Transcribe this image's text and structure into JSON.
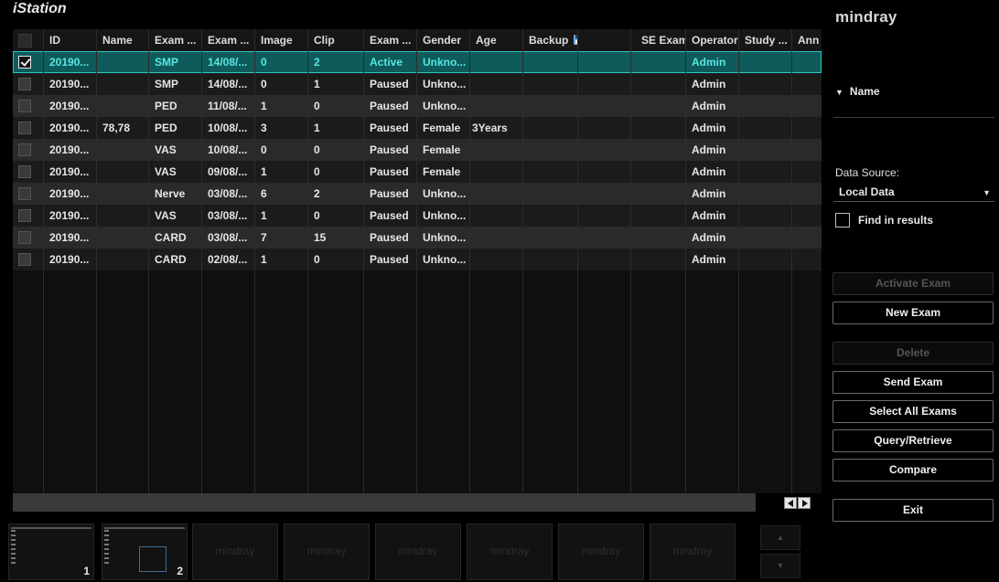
{
  "app": {
    "title": "iStation",
    "brand": "mindray"
  },
  "table": {
    "columns": [
      "ID",
      "Name",
      "Exam ...",
      "Exam ...",
      "Image",
      "Clip",
      "Exam ...",
      "Gender",
      "Age",
      "Backup",
      "",
      "SE Exam",
      "Operator",
      "Study ...",
      "Ann"
    ],
    "rows": [
      {
        "checked": true,
        "cells": [
          "20190...",
          "",
          "SMP",
          "14/08/...",
          "0",
          "2",
          "Active",
          "Unkno...",
          "",
          "",
          "",
          "",
          "Admin",
          "",
          ""
        ]
      },
      {
        "checked": false,
        "cells": [
          "20190...",
          "",
          "SMP",
          "14/08/...",
          "0",
          "1",
          "Paused",
          "Unkno...",
          "",
          "",
          "",
          "",
          "Admin",
          "",
          ""
        ]
      },
      {
        "checked": false,
        "cells": [
          "20190...",
          "",
          "PED",
          "11/08/...",
          "1",
          "0",
          "Paused",
          "Unkno...",
          "",
          "",
          "",
          "",
          "Admin",
          "",
          ""
        ]
      },
      {
        "checked": false,
        "cells": [
          "20190...",
          "78,78",
          "PED",
          "10/08/...",
          "3",
          "1",
          "Paused",
          "Female",
          "3Years",
          "",
          "",
          "",
          "Admin",
          "",
          ""
        ]
      },
      {
        "checked": false,
        "cells": [
          "20190...",
          "",
          "VAS",
          "10/08/...",
          "0",
          "0",
          "Paused",
          "Female",
          "",
          "",
          "",
          "",
          "Admin",
          "",
          ""
        ]
      },
      {
        "checked": false,
        "cells": [
          "20190...",
          "",
          "VAS",
          "09/08/...",
          "1",
          "0",
          "Paused",
          "Female",
          "",
          "",
          "",
          "",
          "Admin",
          "",
          ""
        ]
      },
      {
        "checked": false,
        "cells": [
          "20190...",
          "",
          "Nerve",
          "03/08/...",
          "6",
          "2",
          "Paused",
          "Unkno...",
          "",
          "",
          "",
          "",
          "Admin",
          "",
          ""
        ]
      },
      {
        "checked": false,
        "cells": [
          "20190...",
          "",
          "VAS",
          "03/08/...",
          "1",
          "0",
          "Paused",
          "Unkno...",
          "",
          "",
          "",
          "",
          "Admin",
          "",
          ""
        ]
      },
      {
        "checked": false,
        "cells": [
          "20190...",
          "",
          "CARD",
          "03/08/...",
          "7",
          "15",
          "Paused",
          "Unkno...",
          "",
          "",
          "",
          "",
          "Admin",
          "",
          ""
        ]
      },
      {
        "checked": false,
        "cells": [
          "20190...",
          "",
          "CARD",
          "02/08/...",
          "1",
          "0",
          "Paused",
          "Unkno...",
          "",
          "",
          "",
          "",
          "Admin",
          "",
          ""
        ]
      }
    ],
    "backup_icon": "floppy-disk-icon"
  },
  "panel": {
    "name_label": "Name",
    "data_source_label": "Data Source:",
    "data_source_value": "Local Data",
    "find_in_results": "Find in results",
    "buttons": {
      "activate": "Activate Exam",
      "new_exam": "New Exam",
      "delete": "Delete",
      "send": "Send Exam",
      "select_all": "Select All Exams",
      "query": "Query/Retrieve",
      "compare": "Compare",
      "exit": "Exit"
    }
  },
  "thumbnails": {
    "numbers": [
      "1",
      "2"
    ],
    "watermark": "mindray"
  },
  "colors": {
    "selected_row": "#0f5a5a",
    "selected_text": "#56e8e2",
    "accent_outline": "#2fc6c0"
  }
}
